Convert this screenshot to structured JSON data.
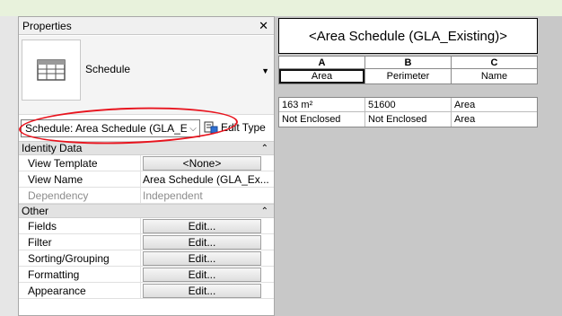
{
  "properties": {
    "title": "Properties",
    "close_glyph": "✕",
    "type_selector": {
      "icon": "schedule-table-icon",
      "name": "Schedule",
      "dropdown_glyph": "▼"
    },
    "instance_combo": {
      "value": "Schedule: Area Schedule (GLA_Ex",
      "chevron": "⌵"
    },
    "edit_type_label": "Edit Type",
    "groups": [
      {
        "label": "Identity Data",
        "collapse_glyph": "⌃",
        "rows": [
          {
            "label": "View Template",
            "value": "<None>",
            "kind": "button"
          },
          {
            "label": "View Name",
            "value": "Area Schedule (GLA_Ex...",
            "kind": "text"
          },
          {
            "label": "Dependency",
            "value": "Independent",
            "kind": "dim"
          }
        ]
      },
      {
        "label": "Other",
        "collapse_glyph": "⌃",
        "rows": [
          {
            "label": "Fields",
            "value": "Edit...",
            "kind": "button"
          },
          {
            "label": "Filter",
            "value": "Edit...",
            "kind": "button"
          },
          {
            "label": "Sorting/Grouping",
            "value": "Edit...",
            "kind": "button"
          },
          {
            "label": "Formatting",
            "value": "Edit...",
            "kind": "button"
          },
          {
            "label": "Appearance",
            "value": "Edit...",
            "kind": "button"
          }
        ]
      }
    ]
  },
  "schedule": {
    "title": "<Area Schedule (GLA_Existing)>",
    "columns": [
      {
        "letter": "A",
        "name": "Area"
      },
      {
        "letter": "B",
        "name": "Perimeter"
      },
      {
        "letter": "C",
        "name": "Name"
      }
    ],
    "rows": [
      [
        "163 m²",
        "51600",
        "Area"
      ],
      [
        "Not Enclosed",
        "Not Enclosed",
        "Area"
      ]
    ]
  },
  "colors": {
    "highlight_oval": "#e8141e",
    "top_strip": "#e8f2dc",
    "canvas": "#c8c8c8"
  }
}
